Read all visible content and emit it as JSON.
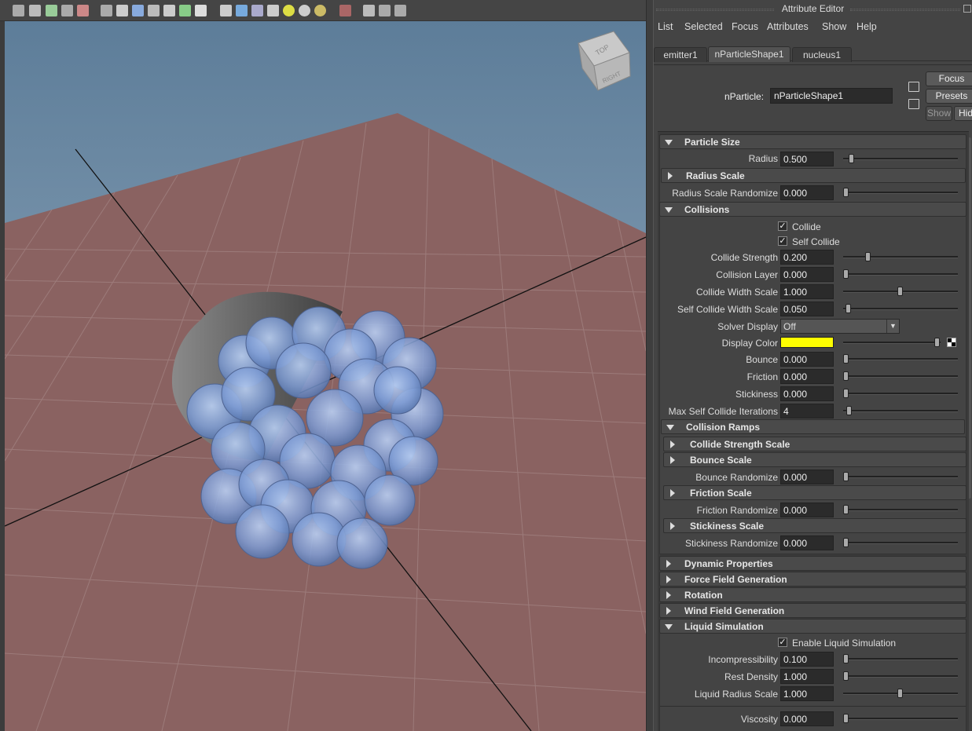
{
  "attribute_editor": {
    "title": "Attribute Editor",
    "menu": [
      "List",
      "Selected",
      "Focus",
      "Attributes",
      "Show",
      "Help"
    ],
    "tabs": [
      "emitter1",
      "nParticleShape1",
      "nucleus1"
    ],
    "active_tab": "nParticleShape1",
    "node_label": "nParticle:",
    "node_name": "nParticleShape1",
    "buttons": {
      "focus": "Focus",
      "presets": "Presets",
      "show": "Show",
      "hide": "Hid"
    },
    "particle_size": {
      "header": "Particle Size",
      "radius": {
        "label": "Radius",
        "value": "0.500",
        "slider": 0.05
      },
      "radius_scale_header": "Radius Scale",
      "radius_scale_randomize": {
        "label": "Radius Scale Randomize",
        "value": "0.000",
        "slider": 0.0
      }
    },
    "collisions": {
      "header": "Collisions",
      "collide": {
        "label": "Collide",
        "checked": true
      },
      "self_collide": {
        "label": "Self Collide",
        "checked": true
      },
      "collide_strength": {
        "label": "Collide Strength",
        "value": "0.200",
        "slider": 0.2
      },
      "collision_layer": {
        "label": "Collision Layer",
        "value": "0.000",
        "slider": 0.0
      },
      "collide_width_scale": {
        "label": "Collide Width Scale",
        "value": "1.000",
        "slider": 0.5
      },
      "self_collide_width_scale": {
        "label": "Self Collide Width Scale",
        "value": "0.050",
        "slider": 0.02
      },
      "solver_display": {
        "label": "Solver Display",
        "value": "Off"
      },
      "display_color": {
        "label": "Display Color",
        "color": "#ffff00",
        "slider": 1.0
      },
      "bounce": {
        "label": "Bounce",
        "value": "0.000",
        "slider": 0.0
      },
      "friction": {
        "label": "Friction",
        "value": "0.000",
        "slider": 0.0
      },
      "stickiness": {
        "label": "Stickiness",
        "value": "0.000",
        "slider": 0.0
      },
      "max_self_collide_iterations": {
        "label": "Max Self Collide Iterations",
        "value": "4",
        "slider": 0.03
      }
    },
    "collision_ramps": {
      "header": "Collision Ramps",
      "collide_strength_scale": "Collide Strength Scale",
      "bounce_scale": "Bounce Scale",
      "bounce_randomize": {
        "label": "Bounce Randomize",
        "value": "0.000",
        "slider": 0.0
      },
      "friction_scale": "Friction Scale",
      "friction_randomize": {
        "label": "Friction Randomize",
        "value": "0.000",
        "slider": 0.0
      },
      "stickiness_scale": "Stickiness Scale",
      "stickiness_randomize": {
        "label": "Stickiness Randomize",
        "value": "0.000",
        "slider": 0.0
      }
    },
    "dynamic_properties": "Dynamic Properties",
    "force_field_generation": "Force Field Generation",
    "rotation": "Rotation",
    "wind_field_generation": "Wind Field Generation",
    "liquid_simulation": {
      "header": "Liquid Simulation",
      "enable": {
        "label": "Enable Liquid Simulation",
        "checked": true
      },
      "incompressibility": {
        "label": "Incompressibility",
        "value": "0.100",
        "slider": 0.0
      },
      "rest_density": {
        "label": "Rest Density",
        "value": "1.000",
        "slider": 0.0
      },
      "liquid_radius_scale": {
        "label": "Liquid Radius Scale",
        "value": "1.000",
        "slider": 0.5
      },
      "viscosity": {
        "label": "Viscosity",
        "value": "0.000",
        "slider": 0.0
      }
    }
  },
  "viewport": {
    "view_cube": {
      "top": "TOP",
      "right": "RIGHT",
      "front": "FRONT"
    },
    "toolbar_icons": [
      "camera-attributes-icon",
      "bookmarks-icon",
      "image-plane-icon",
      "2d-pan-zoom-icon",
      "grease-pencil-icon",
      "grid-icon",
      "film-gate-icon",
      "resolution-gate-icon",
      "gate-mask-icon",
      "field-chart-icon",
      "safe-action-icon",
      "safe-title-icon",
      "wireframe-icon",
      "smooth-shade-icon",
      "wireframe-on-shaded-icon",
      "textured-icon",
      "use-lights-icon",
      "shadows-icon",
      "ambient-occlusion-icon",
      "isolate-select-icon",
      "xray-icon",
      "xray-joints-icon",
      "xray-components-icon"
    ]
  }
}
